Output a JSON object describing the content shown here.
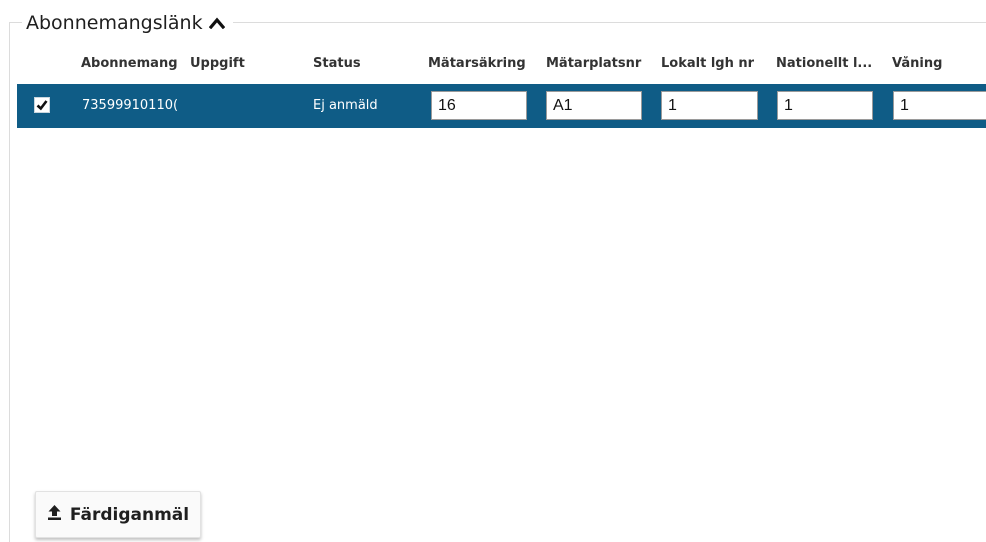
{
  "section": {
    "title": "Abonnemangslänk",
    "toggle_icon": "chevron-up-icon"
  },
  "table": {
    "columns": [
      "Abonnemang",
      "Uppgift",
      "Status",
      "Mätarsäkring",
      "Mätarplatsnr",
      "Lokalt lgh nr",
      "Nationellt l...",
      "Våning"
    ],
    "rows": [
      {
        "checked": true,
        "abonnemang": "73599910110(",
        "uppgift": "",
        "status": "Ej anmäld",
        "matarsakring": "16",
        "matarplatsnr": "A1",
        "lokalt_lgh_nr": "1",
        "nationellt_lgh_nr": "1",
        "vaning": "1"
      }
    ],
    "row_color": "#0f5c86"
  },
  "actions": {
    "submit_label": "Färdiganmäl",
    "submit_icon": "upload-icon"
  }
}
